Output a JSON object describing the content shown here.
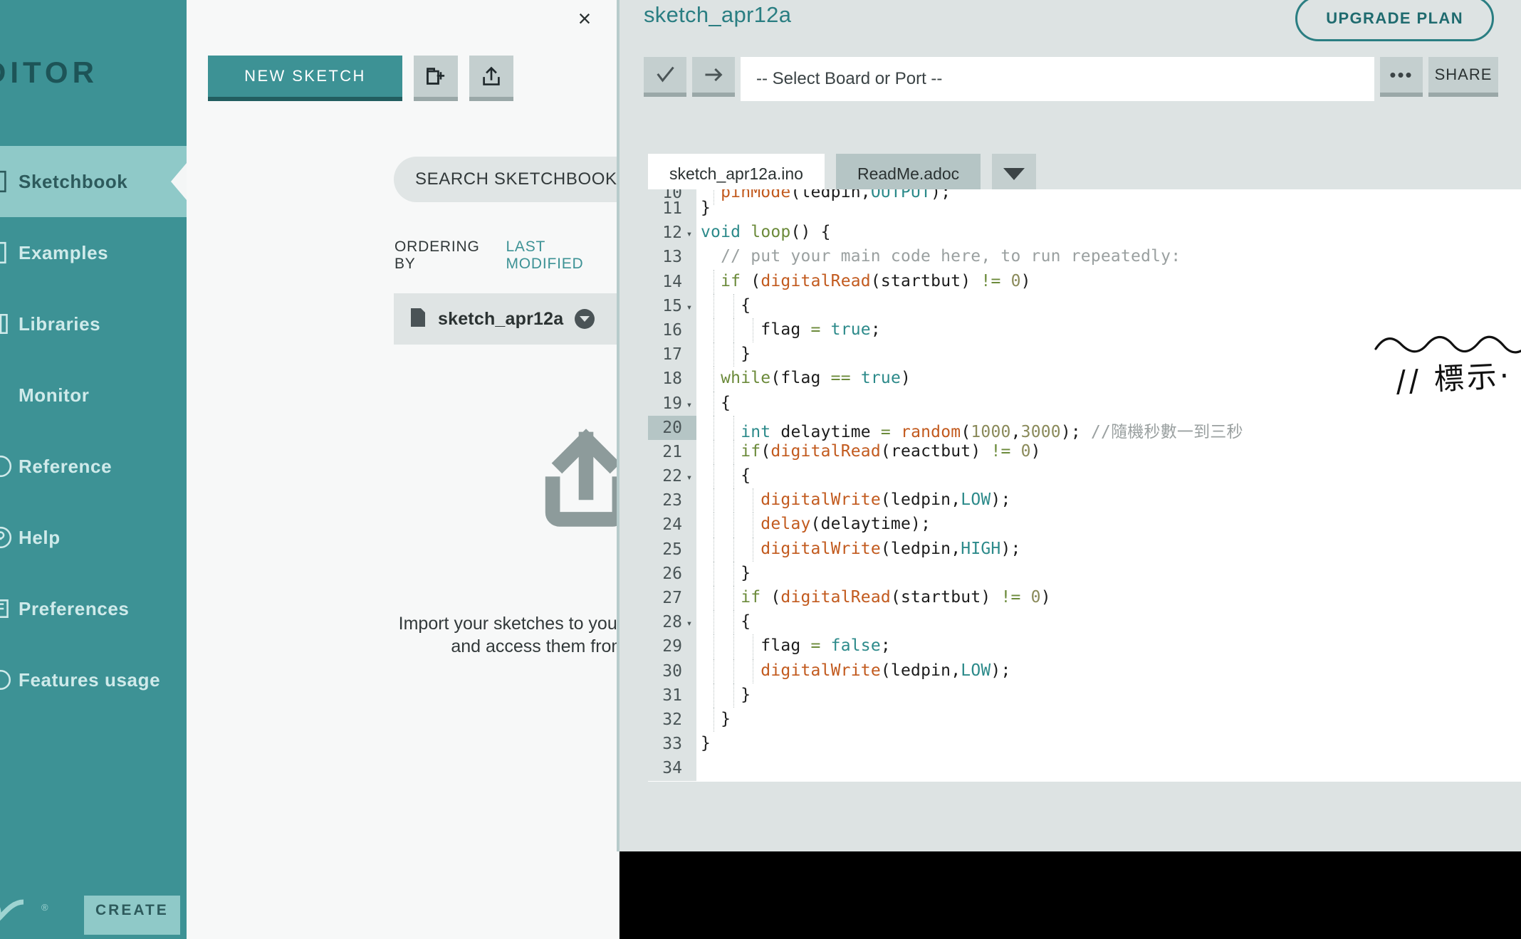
{
  "sidebar": {
    "brand": "EDITOR",
    "items": [
      {
        "label": "Sketchbook",
        "icon": "sketchbook-icon",
        "active": true
      },
      {
        "label": "Examples",
        "icon": "examples-icon",
        "active": false
      },
      {
        "label": "Libraries",
        "icon": "libraries-icon",
        "active": false
      },
      {
        "label": "Monitor",
        "icon": "monitor-icon",
        "active": false
      },
      {
        "label": "Reference",
        "icon": "reference-icon",
        "active": false
      },
      {
        "label": "Help",
        "icon": "help-icon",
        "active": false
      },
      {
        "label": "Preferences",
        "icon": "preferences-icon",
        "active": false
      },
      {
        "label": "Features usage",
        "icon": "features-icon",
        "active": false
      }
    ],
    "logo_text": "CREATE"
  },
  "panel": {
    "close_label": "×",
    "new_sketch_label": "NEW SKETCH",
    "new_folder_icon": "new-folder-icon",
    "import_icon": "upload-icon",
    "search_placeholder": "SEARCH SKETCHBOOK",
    "search_value": "",
    "ordering_label": "ORDERING BY",
    "ordering_value": "LAST MODIFIED",
    "sketches": [
      {
        "name": "sketch_apr12a"
      }
    ],
    "empty_state_text": "Import your sketches to your online Sketchbook and access them from any device!"
  },
  "editor_header": {
    "sketch_title": "sketch_apr12a",
    "upgrade_label": "UPGRADE PLAN",
    "verify_icon": "check-icon",
    "upload_icon": "arrow-right-icon",
    "board_select_value": "-- Select Board or Port --",
    "more_label": "•••",
    "share_label": "SHARE"
  },
  "tabs": [
    {
      "label": "sketch_apr12a.ino",
      "active": true
    },
    {
      "label": "ReadMe.adoc",
      "active": false
    }
  ],
  "colors": {
    "sidebar_bg": "#3d9295",
    "sidebar_active": "#8fc9c8",
    "accent": "#2a7e82",
    "panel_bg": "#f7f8f8",
    "editor_chrome": "#dde3e3",
    "console_bg": "#000000",
    "highlight_line": "#b5c5c5"
  },
  "code": {
    "highlighted_line": 20,
    "lines": [
      {
        "n": 10,
        "fold": false,
        "clipped": true,
        "tokens": [
          {
            "t": "  ",
            "c": "pl"
          },
          {
            "t": "pinMode",
            "c": "fn"
          },
          {
            "t": "(ledpin,",
            "c": "pl"
          },
          {
            "t": "OUTPUT",
            "c": "const"
          },
          {
            "t": ");",
            "c": "pl"
          }
        ]
      },
      {
        "n": 11,
        "fold": false,
        "tokens": [
          {
            "t": "}",
            "c": "pl"
          }
        ]
      },
      {
        "n": 12,
        "fold": true,
        "tokens": [
          {
            "t": "void",
            "c": "type"
          },
          {
            "t": " ",
            "c": "pl"
          },
          {
            "t": "loop",
            "c": "kw"
          },
          {
            "t": "() {",
            "c": "pl"
          }
        ]
      },
      {
        "n": 13,
        "fold": false,
        "tokens": [
          {
            "t": "  // put your main code here, to run repeatedly:",
            "c": "com"
          }
        ]
      },
      {
        "n": 14,
        "fold": false,
        "tokens": [
          {
            "t": "  ",
            "c": "pl"
          },
          {
            "t": "if",
            "c": "kw"
          },
          {
            "t": " (",
            "c": "pl"
          },
          {
            "t": "digitalRead",
            "c": "fn"
          },
          {
            "t": "(startbut) ",
            "c": "pl"
          },
          {
            "t": "!=",
            "c": "op"
          },
          {
            "t": " ",
            "c": "pl"
          },
          {
            "t": "0",
            "c": "num"
          },
          {
            "t": ")",
            "c": "pl"
          }
        ]
      },
      {
        "n": 15,
        "fold": true,
        "tokens": [
          {
            "t": "    {",
            "c": "pl"
          }
        ]
      },
      {
        "n": 16,
        "fold": false,
        "tokens": [
          {
            "t": "      flag ",
            "c": "pl"
          },
          {
            "t": "=",
            "c": "op"
          },
          {
            "t": " ",
            "c": "pl"
          },
          {
            "t": "true",
            "c": "const"
          },
          {
            "t": ";",
            "c": "pl"
          }
        ]
      },
      {
        "n": 17,
        "fold": false,
        "tokens": [
          {
            "t": "    }",
            "c": "pl"
          }
        ]
      },
      {
        "n": 18,
        "fold": false,
        "tokens": [
          {
            "t": "  ",
            "c": "pl"
          },
          {
            "t": "while",
            "c": "kw"
          },
          {
            "t": "(flag ",
            "c": "pl"
          },
          {
            "t": "==",
            "c": "op"
          },
          {
            "t": " ",
            "c": "pl"
          },
          {
            "t": "true",
            "c": "const"
          },
          {
            "t": ")",
            "c": "pl"
          }
        ]
      },
      {
        "n": 19,
        "fold": true,
        "tokens": [
          {
            "t": "  {",
            "c": "pl"
          }
        ]
      },
      {
        "n": 20,
        "fold": false,
        "tokens": [
          {
            "t": "    ",
            "c": "pl"
          },
          {
            "t": "int",
            "c": "type"
          },
          {
            "t": " delaytime ",
            "c": "pl"
          },
          {
            "t": "=",
            "c": "op"
          },
          {
            "t": " ",
            "c": "pl"
          },
          {
            "t": "random",
            "c": "fn"
          },
          {
            "t": "(",
            "c": "pl"
          },
          {
            "t": "1000",
            "c": "num"
          },
          {
            "t": ",",
            "c": "pl"
          },
          {
            "t": "3000",
            "c": "num"
          },
          {
            "t": "); ",
            "c": "pl"
          },
          {
            "t": "//隨機秒數一到三秒",
            "c": "com"
          }
        ]
      },
      {
        "n": 21,
        "fold": false,
        "tokens": [
          {
            "t": "    ",
            "c": "pl"
          },
          {
            "t": "if",
            "c": "kw"
          },
          {
            "t": "(",
            "c": "pl"
          },
          {
            "t": "digitalRead",
            "c": "fn"
          },
          {
            "t": "(reactbut) ",
            "c": "pl"
          },
          {
            "t": "!=",
            "c": "op"
          },
          {
            "t": " ",
            "c": "pl"
          },
          {
            "t": "0",
            "c": "num"
          },
          {
            "t": ")",
            "c": "pl"
          }
        ]
      },
      {
        "n": 22,
        "fold": true,
        "tokens": [
          {
            "t": "    {",
            "c": "pl"
          }
        ]
      },
      {
        "n": 23,
        "fold": false,
        "tokens": [
          {
            "t": "      ",
            "c": "pl"
          },
          {
            "t": "digitalWrite",
            "c": "fn"
          },
          {
            "t": "(ledpin,",
            "c": "pl"
          },
          {
            "t": "LOW",
            "c": "const"
          },
          {
            "t": ");",
            "c": "pl"
          }
        ]
      },
      {
        "n": 24,
        "fold": false,
        "tokens": [
          {
            "t": "      ",
            "c": "pl"
          },
          {
            "t": "delay",
            "c": "fn"
          },
          {
            "t": "(delaytime);",
            "c": "pl"
          }
        ]
      },
      {
        "n": 25,
        "fold": false,
        "tokens": [
          {
            "t": "      ",
            "c": "pl"
          },
          {
            "t": "digitalWrite",
            "c": "fn"
          },
          {
            "t": "(ledpin,",
            "c": "pl"
          },
          {
            "t": "HIGH",
            "c": "const"
          },
          {
            "t": ");",
            "c": "pl"
          }
        ]
      },
      {
        "n": 26,
        "fold": false,
        "tokens": [
          {
            "t": "    }",
            "c": "pl"
          }
        ]
      },
      {
        "n": 27,
        "fold": false,
        "tokens": [
          {
            "t": "    ",
            "c": "pl"
          },
          {
            "t": "if",
            "c": "kw"
          },
          {
            "t": " (",
            "c": "pl"
          },
          {
            "t": "digitalRead",
            "c": "fn"
          },
          {
            "t": "(startbut) ",
            "c": "pl"
          },
          {
            "t": "!=",
            "c": "op"
          },
          {
            "t": " ",
            "c": "pl"
          },
          {
            "t": "0",
            "c": "num"
          },
          {
            "t": ")",
            "c": "pl"
          }
        ]
      },
      {
        "n": 28,
        "fold": true,
        "tokens": [
          {
            "t": "    {",
            "c": "pl"
          }
        ]
      },
      {
        "n": 29,
        "fold": false,
        "tokens": [
          {
            "t": "      flag ",
            "c": "pl"
          },
          {
            "t": "=",
            "c": "op"
          },
          {
            "t": " ",
            "c": "pl"
          },
          {
            "t": "false",
            "c": "const"
          },
          {
            "t": ";",
            "c": "pl"
          }
        ]
      },
      {
        "n": 30,
        "fold": false,
        "tokens": [
          {
            "t": "      ",
            "c": "pl"
          },
          {
            "t": "digitalWrite",
            "c": "fn"
          },
          {
            "t": "(ledpin,",
            "c": "pl"
          },
          {
            "t": "LOW",
            "c": "const"
          },
          {
            "t": ");",
            "c": "pl"
          }
        ]
      },
      {
        "n": 31,
        "fold": false,
        "tokens": [
          {
            "t": "    }",
            "c": "pl"
          }
        ]
      },
      {
        "n": 32,
        "fold": false,
        "tokens": [
          {
            "t": "  }",
            "c": "pl"
          }
        ]
      },
      {
        "n": 33,
        "fold": false,
        "tokens": [
          {
            "t": "}",
            "c": "pl"
          }
        ]
      },
      {
        "n": 34,
        "fold": false,
        "clipped": true,
        "tokens": [
          {
            "t": "",
            "c": "pl"
          }
        ]
      }
    ]
  },
  "annotations": {
    "squiggle": "hand-drawn-wavy-underline",
    "handwriting": "// 標示·"
  }
}
